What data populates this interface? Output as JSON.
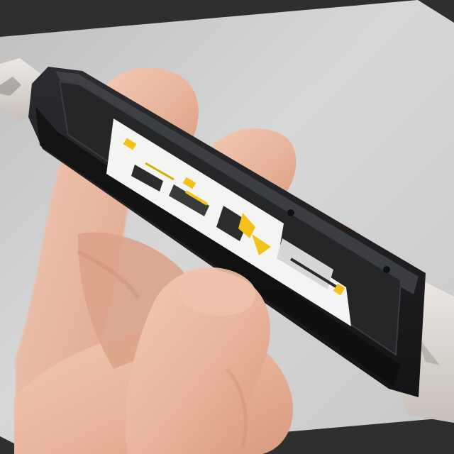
{
  "photo": {
    "subject": "",
    "label_steps": [
      {
        "text": ""
      },
      {
        "text": ""
      },
      {
        "text": ""
      },
      {
        "text": ""
      }
    ]
  },
  "colors": {
    "border": "#2f2f2f",
    "background": "#cfcfcf",
    "skin": "#e9b9a0",
    "skin_shadow": "#c98d73",
    "body_black": "#1c1d1f",
    "label_white": "#f4f4f2",
    "accent_yellow": "#f3c21a",
    "blade_silver": "#d9d4d0"
  }
}
